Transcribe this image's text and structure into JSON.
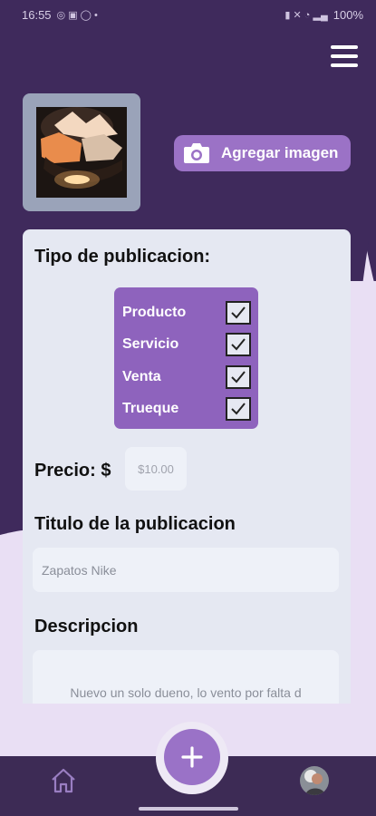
{
  "status_bar": {
    "time": "16:55",
    "battery": "100%"
  },
  "colors": {
    "header_bg": "#3f2a5c",
    "page_bg": "#e9dff4",
    "accent": "#9b72c6",
    "card_bg": "#e5e8f2",
    "nav_bg": "#3d2b55"
  },
  "header": {
    "menu_icon": "hamburger-menu-icon"
  },
  "image_picker": {
    "button_label": "Agregar imagen",
    "button_icon": "camera-icon"
  },
  "form": {
    "type_section_title": "Tipo de publicacion:",
    "types": [
      {
        "label": "Producto",
        "checked": true
      },
      {
        "label": "Servicio",
        "checked": true
      },
      {
        "label": "Venta",
        "checked": true
      },
      {
        "label": "Trueque",
        "checked": true
      }
    ],
    "price_label": "Precio: $",
    "price_placeholder": "$10.00",
    "title_section": "Titulo de la publicacion",
    "title_placeholder": "Zapatos Nike",
    "description_section": "Descripcion",
    "description_value": "Nuevo un solo dueno, lo vento por falta d"
  },
  "bottom_nav": {
    "home_icon": "home-icon",
    "add_icon": "plus-icon",
    "profile_icon": "avatar"
  }
}
